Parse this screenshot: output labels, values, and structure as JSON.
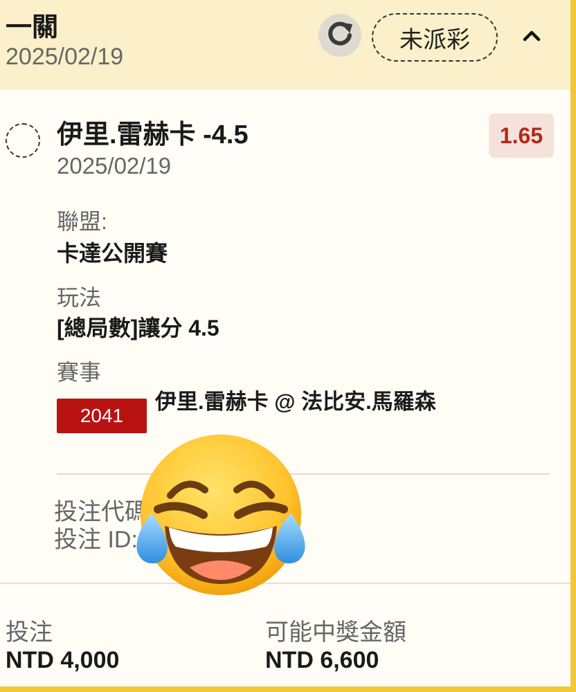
{
  "header": {
    "title": "一關",
    "date": "2025/02/19",
    "status": "未派彩"
  },
  "selection": {
    "title": "伊里.雷赫卡 -4.5",
    "date": "2025/02/19",
    "odds": "1.65"
  },
  "details": {
    "league_label": "聯盟:",
    "league_value": "卡達公開賽",
    "market_label": "玩法",
    "market_value": "[總局數]讓分 4.5",
    "event_label": "賽事",
    "event_id": "2041",
    "event_name": "伊里.雷赫卡 @ 法比安.馬羅森"
  },
  "bet_info": {
    "code_label": "投注代碼",
    "id_label": "投注 ID:"
  },
  "footer": {
    "stake_label": "投注",
    "stake_value": "NTD 4,000",
    "win_label": "可能中獎金額",
    "win_value": "NTD 6,600"
  },
  "icons": {
    "refresh": "refresh-icon",
    "collapse": "chevron-up-icon",
    "overlay": "tears-of-joy-emoji"
  },
  "colors": {
    "header_bg": "#fbf0c9",
    "accent_border": "#f2c73a",
    "odds": "#b02a1a",
    "event_badge": "#b81212"
  }
}
